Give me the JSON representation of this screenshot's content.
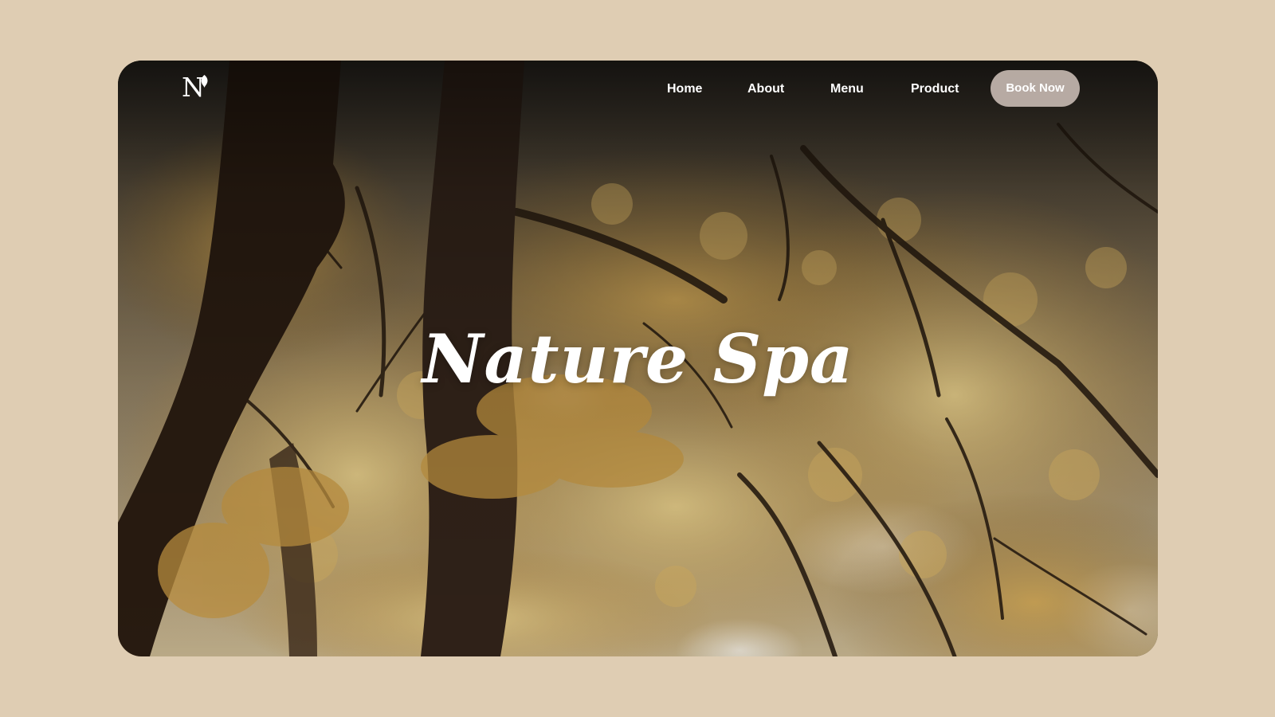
{
  "page": {
    "background_color": "#dfcdb3"
  },
  "nav": {
    "logo_letter": "N",
    "logo_icon": "leaf-icon",
    "links": [
      {
        "label": "Home"
      },
      {
        "label": "About"
      },
      {
        "label": "Menu"
      },
      {
        "label": "Product"
      }
    ],
    "cta_label": "Book Now",
    "cta_color": "#c8bab2"
  },
  "hero": {
    "title": "Nature Spa",
    "background_description_icon": "autumn-forest-canopy-image",
    "foliage_color": "#c79a45"
  }
}
